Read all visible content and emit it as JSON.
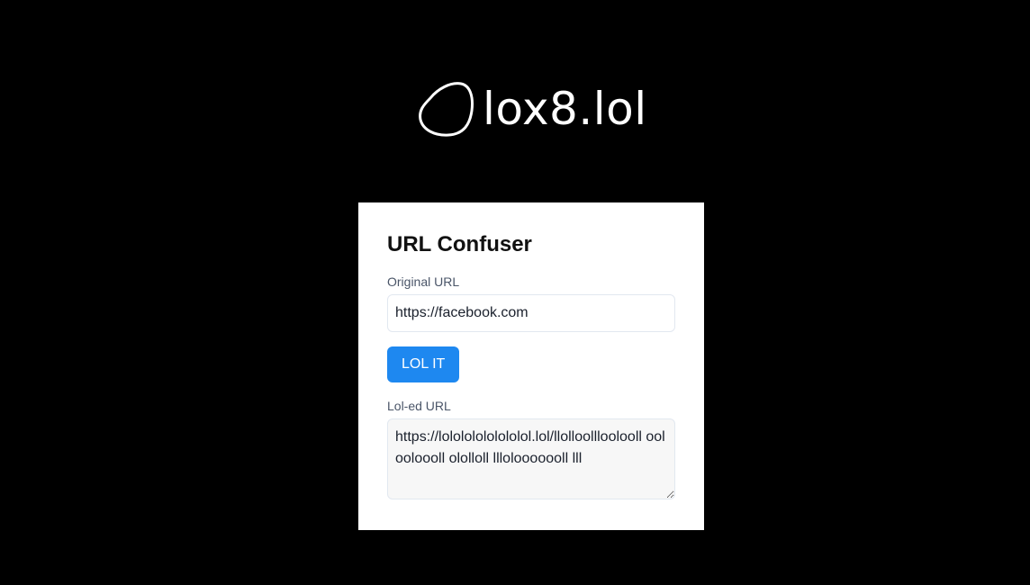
{
  "logo": {
    "icon": "blob-outline-icon",
    "text": "lox8.lol"
  },
  "card": {
    "title": "URL Confuser",
    "original_url_label": "Original URL",
    "original_url_value": "https://facebook.com",
    "button_label": "LOL IT",
    "loled_url_label": "Lol-ed URL",
    "loled_url_value": "https://lolololololololol.lol/llolloollloolooll oolooloooll ololloll lllolooooooll lll"
  },
  "colors": {
    "background": "#000000",
    "card": "#ffffff",
    "button": "#1e88f0",
    "label": "#4a5568"
  }
}
